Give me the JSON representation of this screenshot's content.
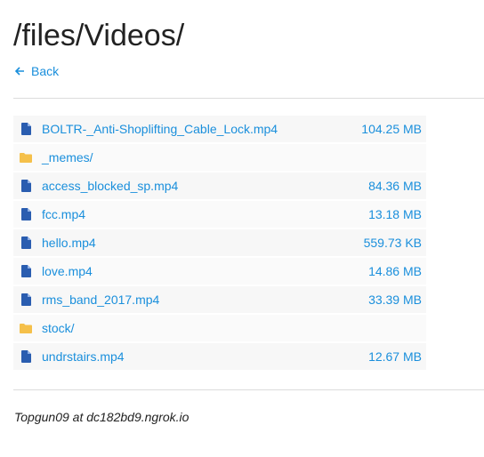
{
  "page": {
    "title": "/files/Videos/",
    "back_label": "Back",
    "footer": "Topgun09 at dc182bd9.ngrok.io"
  },
  "colors": {
    "link": "#1a8fdc",
    "file_icon": "#2a5db0",
    "folder_icon": "#f5c04a"
  },
  "entries": [
    {
      "name": "BOLTR-_Anti-Shoplifting_Cable_Lock.mp4",
      "size": "104.25 MB",
      "icon": "file-icon"
    },
    {
      "name": "_memes/",
      "size": "",
      "icon": "folder-icon"
    },
    {
      "name": "access_blocked_sp.mp4",
      "size": "84.36 MB",
      "icon": "file-icon"
    },
    {
      "name": "fcc.mp4",
      "size": "13.18 MB",
      "icon": "file-icon"
    },
    {
      "name": "hello.mp4",
      "size": "559.73 KB",
      "icon": "file-icon"
    },
    {
      "name": "love.mp4",
      "size": "14.86 MB",
      "icon": "file-icon"
    },
    {
      "name": "rms_band_2017.mp4",
      "size": "33.39 MB",
      "icon": "file-icon"
    },
    {
      "name": "stock/",
      "size": "",
      "icon": "folder-icon"
    },
    {
      "name": "undrstairs.mp4",
      "size": "12.67 MB",
      "icon": "file-icon"
    }
  ]
}
